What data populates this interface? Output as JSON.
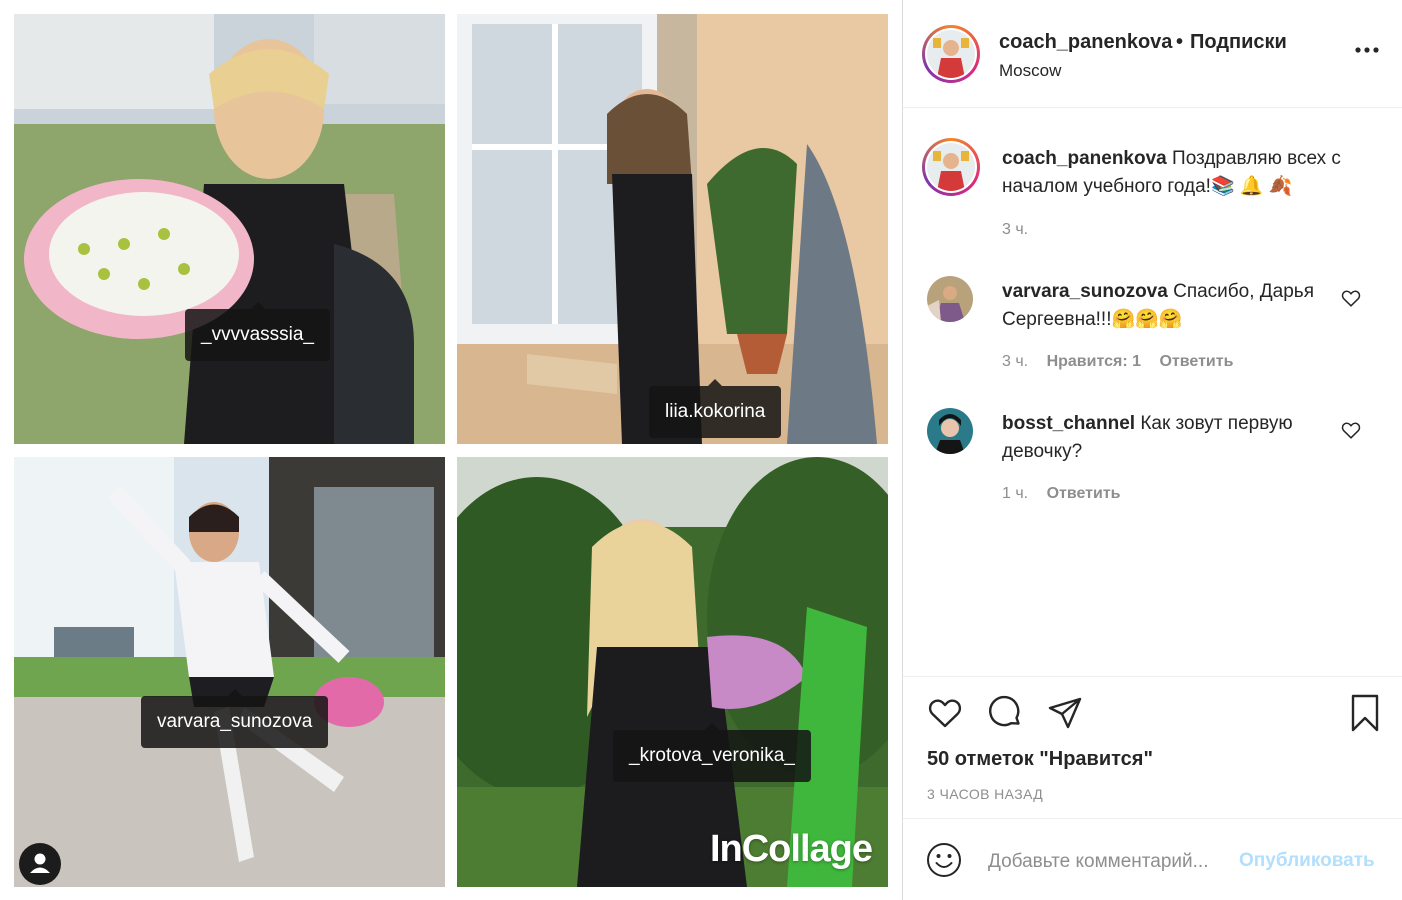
{
  "media": {
    "tags": [
      "_vvvvasssia_",
      "liia.kokorina",
      "varvara_sunozova",
      "_krotova_veronika_"
    ],
    "watermark": "InCollage",
    "user_badge_icon": "person-icon"
  },
  "header": {
    "username": "coach_panenkova",
    "separator": "•",
    "follow_label": "Подписки",
    "location": "Moscow",
    "more_icon": "more-horizontal-icon"
  },
  "caption": {
    "username": "coach_panenkova",
    "text": "Поздравляю всех с началом учебного года!📚 🔔 🍂",
    "time": "3 ч."
  },
  "comments": [
    {
      "username": "varvara_sunozova",
      "text": "Спасибо, Дарья Сергеевна!!!🤗🤗🤗",
      "time": "3 ч.",
      "likes_label": "Нравится: 1",
      "reply_label": "Ответить"
    },
    {
      "username": "bosst_channel",
      "text": "Как зовут первую девочку?",
      "time": "1 ч.",
      "reply_label": "Ответить"
    }
  ],
  "actions": {
    "icons": [
      "heart-icon",
      "comment-icon",
      "share-icon",
      "bookmark-icon"
    ],
    "likes": "50 отметок \"Нравится\"",
    "time_ago": "3 ЧАСОВ НАЗАД"
  },
  "add_comment": {
    "placeholder": "Добавьте комментарий...",
    "publish_label": "Опубликовать"
  },
  "colors": {
    "text": "#262626",
    "muted": "#8e8e8e",
    "publish_disabled": "#b2dffc",
    "border": "#dbdbdb"
  }
}
